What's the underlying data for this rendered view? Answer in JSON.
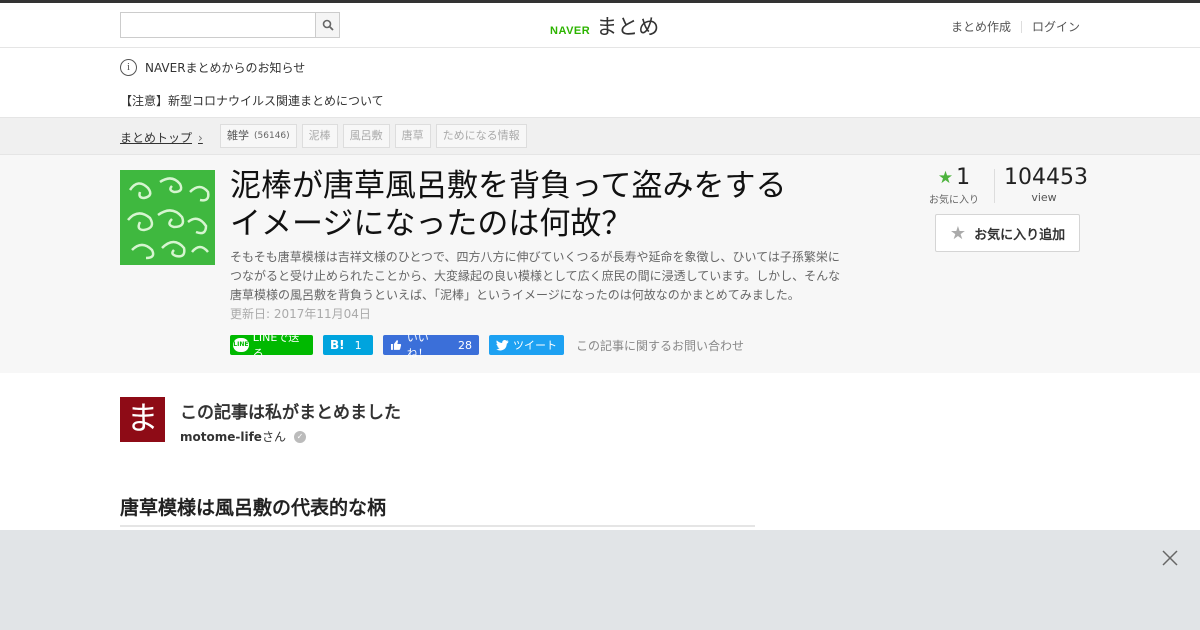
{
  "header": {
    "search_placeholder": "",
    "logo_naver": "NAVER",
    "logo_matome": "まとめ",
    "create_link": "まとめ作成",
    "login_link": "ログイン"
  },
  "notice": {
    "info_label": "NAVERまとめからのお知らせ",
    "item": "【注意】新型コロナウイルス関連まとめについて"
  },
  "breadcrumb": {
    "top": "まとめトップ",
    "tags": [
      {
        "label": "雑学",
        "count": "(56146)"
      },
      {
        "label": "泥棒"
      },
      {
        "label": "風呂敷"
      },
      {
        "label": "唐草"
      },
      {
        "label": "ためになる情報"
      }
    ]
  },
  "article": {
    "title_line1": "泥棒が唐草風呂敷を背負って盗みをする",
    "title_line2": "イメージになったのは何故？",
    "description": "そもそも唐草模様は吉祥文様のひとつで、四方八方に伸びていくつるが長寿や延命を象徴し、ひいては子孫繁栄につながると受け止められたことから、大変縁起の良い模様として広く庶民の間に浸透しています。しかし、そんな唐草模様の風呂敷を背負うといえば、「泥棒」というイメージになったのは何故なのかまとめてみました。",
    "updated": "更新日: 2017年11月04日",
    "favorites": "1",
    "favorites_label": "お気に入り",
    "views": "104453",
    "views_label": "view",
    "fav_button": "お気に入り追加"
  },
  "share": {
    "line": "LINEで送る",
    "line_icon_text": "LINE",
    "hatena_icon": "B!",
    "hatena_count": "1",
    "fb_label": "いいね！",
    "fb_count": "28",
    "tweet": "ツイート",
    "contact": "この記事に関するお問い合わせ"
  },
  "author": {
    "heading": "この記事は私がまとめました",
    "avatar_char": "ま",
    "name": "motome-life",
    "suffix": "さん"
  },
  "section": {
    "heading": "唐草模様は風呂敷の代表的な柄"
  },
  "colors": {
    "brand_green": "#2db400",
    "star_green": "#4db33d",
    "line_green": "#00b900",
    "hatena_blue": "#00a4de",
    "facebook_blue": "#3b6fd9",
    "twitter_blue": "#1da1f2",
    "avatar_red": "#8e0b16"
  },
  "icons": [
    "search-icon",
    "info-icon",
    "chevron-right-icon",
    "star-icon",
    "verified-icon",
    "close-icon",
    "line-icon",
    "hatena-icon",
    "thumbs-up-icon",
    "twitter-bird-icon"
  ]
}
